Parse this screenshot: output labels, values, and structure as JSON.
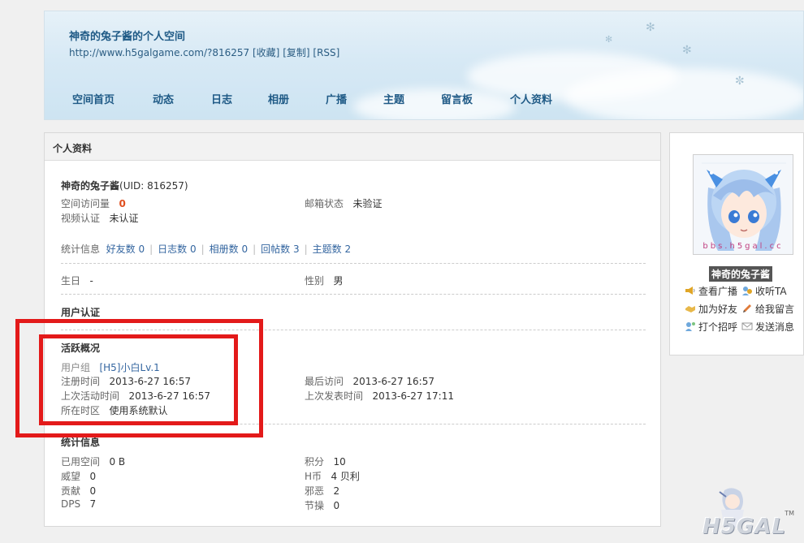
{
  "header": {
    "title": "神奇的兔子酱的个人空间",
    "url": "http://www.h5galgame.com/?816257",
    "links": [
      "[收藏]",
      "[复制]",
      "[RSS]"
    ],
    "nav": [
      "空间首页",
      "动态",
      "日志",
      "相册",
      "广播",
      "主题",
      "留言板",
      "个人资料"
    ]
  },
  "main": {
    "panel_title": "个人资料",
    "name": "神奇的兔子酱",
    "uid": "(UID: 816257)",
    "visits_label": "空间访问量",
    "visits_value": "0",
    "email_label": "邮箱状态",
    "email_value": "未验证",
    "video_label": "视频认证",
    "video_value": "未认证",
    "stats_label": "统计信息",
    "stats": [
      "好友数 0",
      "日志数 0",
      "相册数 0",
      "回帖数 3",
      "主题数 2"
    ],
    "birthday_label": "生日",
    "birthday_value": "-",
    "gender_label": "性别",
    "gender_value": "男",
    "auth_title": "用户认证",
    "activity_title": "活跃概况",
    "group_label": "用户组",
    "group_value": "[H5]小白Lv.1",
    "reg_label": "注册时间",
    "reg_value": "2013-6-27 16:57",
    "last_visit_label": "最后访问",
    "last_visit_value": "2013-6-27 16:57",
    "last_active_label": "上次活动时间",
    "last_active_value": "2013-6-27 16:57",
    "last_post_label": "上次发表时间",
    "last_post_value": "2013-6-27 17:11",
    "tz_label": "所在时区",
    "tz_value": "使用系统默认",
    "stat_title": "统计信息",
    "space_label": "已用空间",
    "space_value": "0 B",
    "points_label": "积分",
    "points_value": "10",
    "prestige_label": "威望",
    "prestige_value": "0",
    "coin_label": "H币",
    "coin_value": "4 贝利",
    "contrib_label": "贡献",
    "contrib_value": "0",
    "evil_label": "邪恶",
    "evil_value": "2",
    "dps_label": "DPS",
    "dps_value": "7",
    "integrity_label": "节操",
    "integrity_value": "0"
  },
  "side": {
    "avatar_watermark": "bbs.h5gal.cc",
    "username": "神奇的兔子酱",
    "actions": [
      "查看广播",
      "收听TA",
      "加为好友",
      "给我留言",
      "打个招呼",
      "发送消息"
    ]
  },
  "mascot": {
    "logo": "H5GAL",
    "tm": "TM"
  },
  "colors": {
    "accent_red": "#e31a1a",
    "link_blue": "#3466a0",
    "header_blue": "#1f5a86"
  }
}
